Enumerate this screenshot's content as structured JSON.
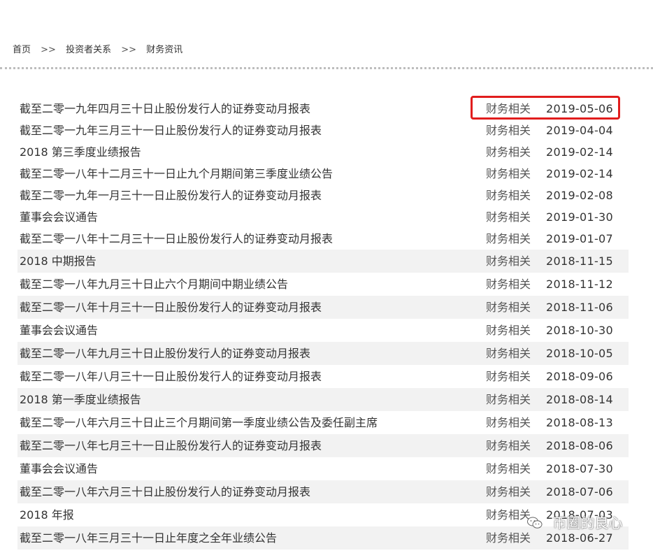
{
  "breadcrumb": {
    "home": "首页",
    "separator": ">>",
    "investor": "投资者关系",
    "current": "财务资讯"
  },
  "colors": {
    "highlight_box": "#e11d1d",
    "row_shade": "#f2f2f2"
  },
  "rows": [
    {
      "title": "截至二零一九年四月三十日止股份发行人的证券变动月报表",
      "category": "财务相关",
      "date": "2019-05-06"
    },
    {
      "title": "截至二零一九年三月三十一日止股份发行人的证券变动月报表",
      "category": "财务相关",
      "date": "2019-04-04"
    },
    {
      "title": "2018 第三季度业绩报告",
      "category": "财务相关",
      "date": "2019-02-14"
    },
    {
      "title": "截至二零一八年十二月三十一日止九个月期间第三季度业绩公告",
      "category": "财务相关",
      "date": "2019-02-14"
    },
    {
      "title": "截至二零一九年一月三十一日止股份发行人的证券变动月报表",
      "category": "财务相关",
      "date": "2019-02-08"
    },
    {
      "title": "董事会会议通告",
      "category": "财务相关",
      "date": "2019-01-30"
    },
    {
      "title": "截至二零一八年十二月三十一日止股份发行人的证券变动月报表",
      "category": "财务相关",
      "date": "2019-01-07"
    },
    {
      "title": "2018 中期报告",
      "category": "财务相关",
      "date": "2018-11-15"
    },
    {
      "title": "截至二零一八年九月三十日止六个月期间中期业绩公告",
      "category": "财务相关",
      "date": "2018-11-12"
    },
    {
      "title": "截至二零一八年十月三十一日止股份发行人的证券变动月报表",
      "category": "财务相关",
      "date": "2018-11-06"
    },
    {
      "title": "董事会会议通告",
      "category": "财务相关",
      "date": "2018-10-30"
    },
    {
      "title": "截至二零一八年九月三十日止股份发行人的证券变动月报表",
      "category": "财务相关",
      "date": "2018-10-05"
    },
    {
      "title": "截至二零一八年八月三十一日止股份发行人的证券变动月报表",
      "category": "财务相关",
      "date": "2018-09-06"
    },
    {
      "title": "2018 第一季度业绩报告",
      "category": "财务相关",
      "date": "2018-08-14"
    },
    {
      "title": "截至二零一八年六月三十日止三个月期间第一季度业绩公告及委任副主席",
      "category": "财务相关",
      "date": "2018-08-13"
    },
    {
      "title": "截至二零一八年七月三十一日止股份发行人的证券变动月报表",
      "category": "财务相关",
      "date": "2018-08-06"
    },
    {
      "title": "董事会会议通告",
      "category": "财务相关",
      "date": "2018-07-30"
    },
    {
      "title": "截至二零一八年六月三十日止股份发行人的证券变动月报表",
      "category": "财务相关",
      "date": "2018-07-06"
    },
    {
      "title": "2018 年报",
      "category": "财务相关",
      "date": "2018-07-03"
    },
    {
      "title": "截至二零一八年三月三十一日止年度之全年业绩公告",
      "category": "财务相关",
      "date": "2018-06-27"
    }
  ],
  "watermark": {
    "text": "币圈的良心",
    "icon": "wechat-icon"
  }
}
